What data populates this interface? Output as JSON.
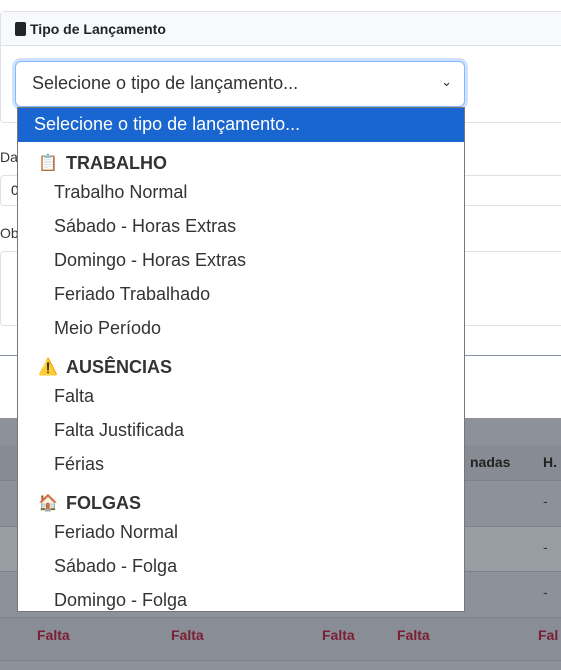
{
  "card": {
    "title": "Tipo de Lançamento",
    "icon": "clipboard-icon"
  },
  "select": {
    "value": "Selecione o tipo de lançamento..."
  },
  "labels": {
    "date": "Da",
    "date_value": "0",
    "obs": "Ob"
  },
  "table": {
    "header_partial": "nadas",
    "header_h": "H.",
    "dash": "-",
    "falta": "Falta",
    "falta_partial": "Fal"
  },
  "dropdown": {
    "placeholder": "Selecione o tipo de lançamento...",
    "groups": [
      {
        "icon": "clipboard-icon",
        "label": "TRABALHO",
        "options": [
          "Trabalho Normal",
          "Sábado - Horas Extras",
          "Domingo - Horas Extras",
          "Feriado Trabalhado",
          "Meio Período"
        ]
      },
      {
        "icon": "warning-icon",
        "label": "AUSÊNCIAS",
        "options": [
          "Falta",
          "Falta Justificada",
          "Férias"
        ]
      },
      {
        "icon": "house-icon",
        "label": "FOLGAS",
        "options": [
          "Feriado Normal",
          "Sábado - Folga",
          "Domingo - Folga"
        ]
      }
    ]
  },
  "colors": {
    "accent": "#1a66d0",
    "falta": "#7a1f33"
  }
}
